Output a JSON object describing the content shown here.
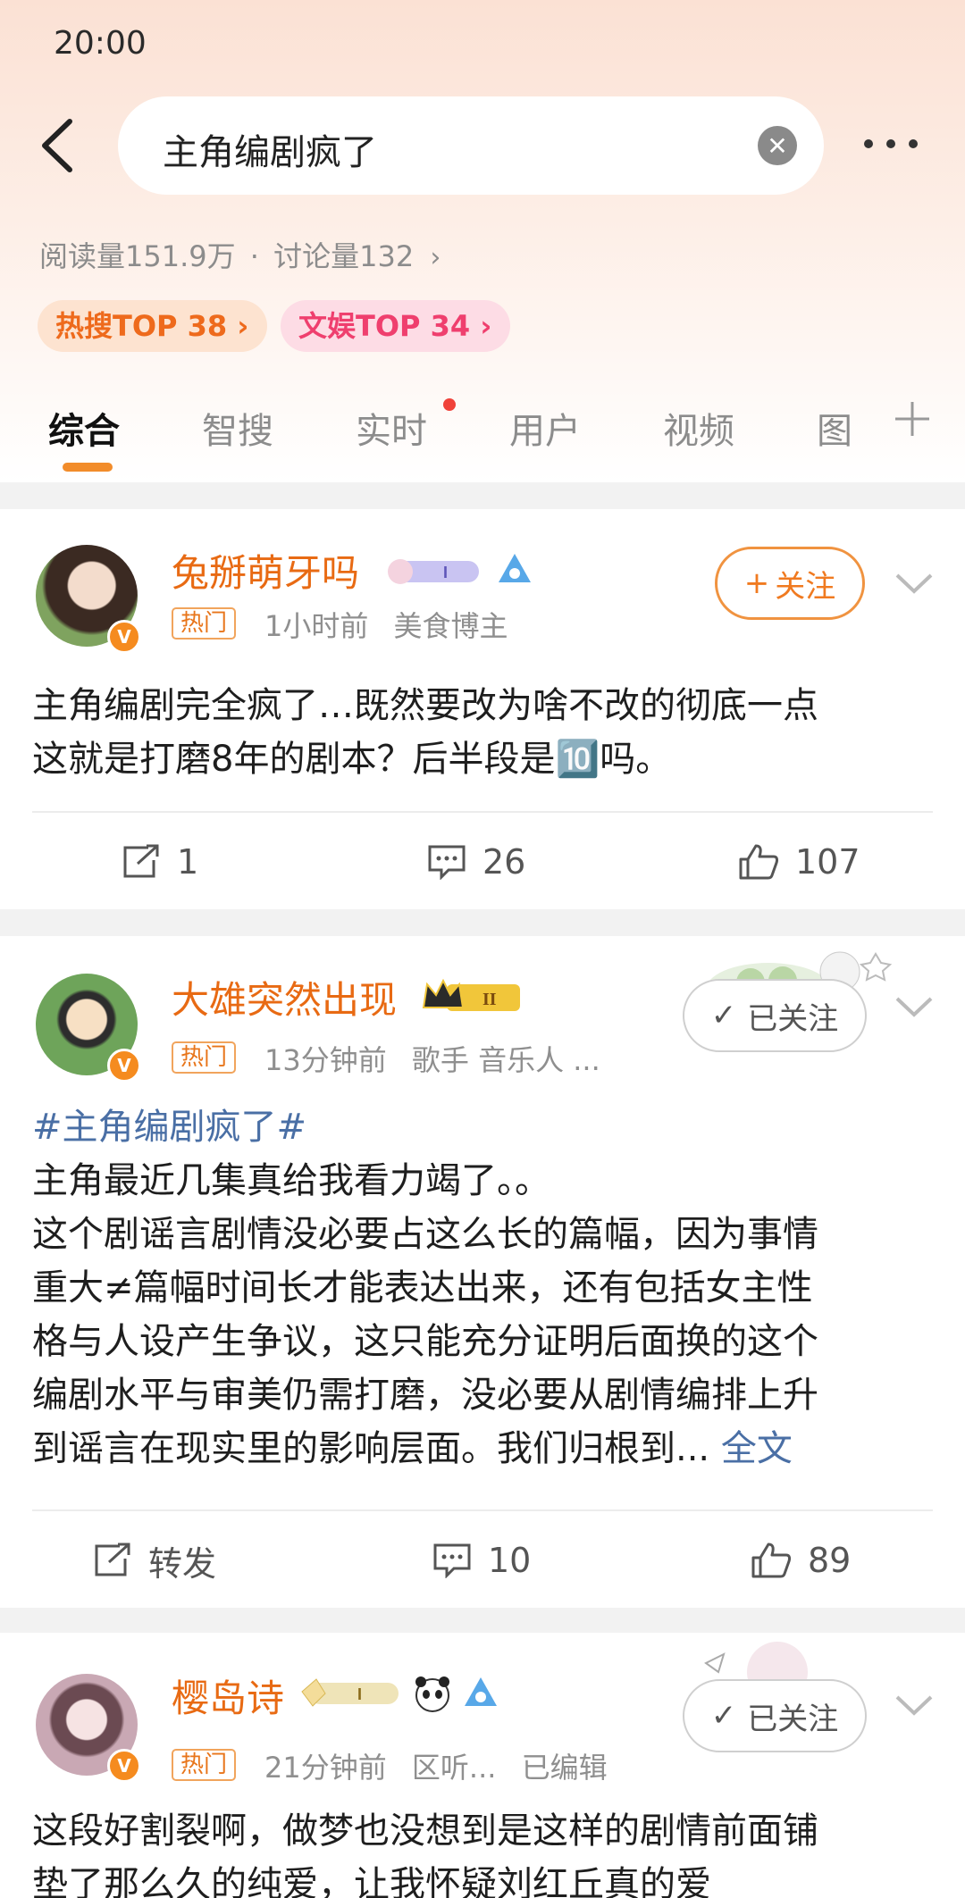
{
  "status_bar": {
    "time": "20:00"
  },
  "search": {
    "query": "主角编剧疯了"
  },
  "stats": {
    "reads": "阅读量151.9万",
    "separator": "·",
    "discussions": "讨论量132",
    "chevron": "›"
  },
  "rank_tags": [
    {
      "label": "热搜TOP 38 ›"
    },
    {
      "label": "文娱TOP 34 ›"
    }
  ],
  "tabs": [
    {
      "label": "综合"
    },
    {
      "label": "智搜"
    },
    {
      "label": "实时"
    },
    {
      "label": "用户"
    },
    {
      "label": "视频"
    },
    {
      "label": "图"
    }
  ],
  "posts": [
    {
      "username": "兔掰萌牙吗",
      "hot_tag": "热门",
      "meta": [
        "1小时前",
        "美食博主"
      ],
      "follow_label": "关注",
      "follow_prefix": "+",
      "text_lines": [
        "主角编剧完全疯了…既然要改为啥不改的彻底一点",
        "这就是打磨8年的剧本？后半段是🔟吗。"
      ],
      "repost": "1",
      "comments": "26",
      "likes": "107"
    },
    {
      "username": "大雄突然出现",
      "hot_tag": "热门",
      "meta": [
        "13分钟前",
        "歌手 音乐人 ..."
      ],
      "follow_label": "已关注",
      "hashtag": "#主角编剧疯了#",
      "text_lines": [
        "主角最近几集真给我看力竭了。。",
        "这个剧谣言剧情没必要占这么长的篇幅，因为事情",
        "重大≠篇幅时间长才能表达出来，还有包括女主性",
        "格与人设产生争议，这只能充分证明后面换的这个",
        "编剧水平与审美仍需打磨，没必要从剧情编排上升",
        "到谣言在现实里的影响层面。我们归根到..."
      ],
      "full_text": "全文",
      "repost": "转发",
      "comments": "10",
      "likes": "89"
    },
    {
      "username": "樱岛诗",
      "hot_tag": "热门",
      "meta": [
        "21分钟前",
        "区听...",
        "已编辑"
      ],
      "follow_label": "已关注",
      "text_lines": [
        "这段好割裂啊，做梦也没想到是这样的剧情前面铺",
        "垫了那么久的纯爱，让我怀疑刘红丘真的爱"
      ]
    }
  ],
  "colors": {
    "accent": "#f28c2a",
    "username": "#e86a13",
    "link": "#4a6fa5"
  }
}
